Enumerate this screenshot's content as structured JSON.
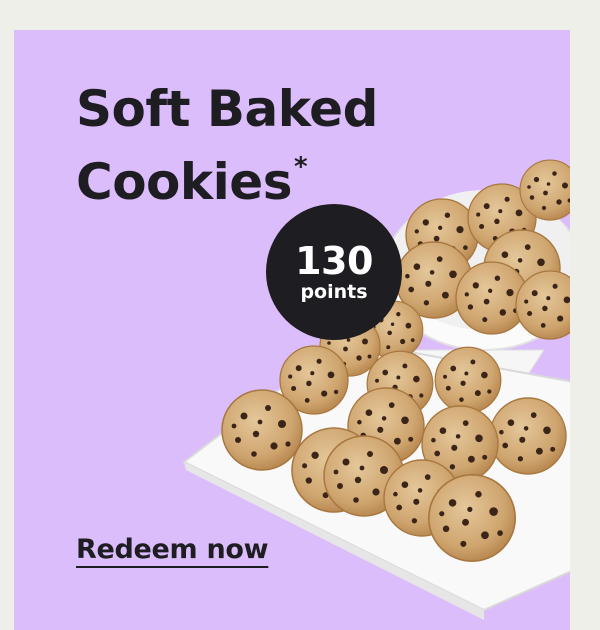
{
  "promo": {
    "title_line1": "Soft Baked",
    "title_line2": "Cookies",
    "title_mark": "*",
    "points_value": "130",
    "points_unit": "points",
    "cta_label": "Redeem now"
  },
  "colors": {
    "page_background": "#efefea",
    "card_background": "#dcbdfc",
    "text_dark": "#1e1d22",
    "badge_text": "#ffffff"
  },
  "image": {
    "subject": "chocolate-chip-cookies-on-white-platter-and-cake-stand"
  }
}
